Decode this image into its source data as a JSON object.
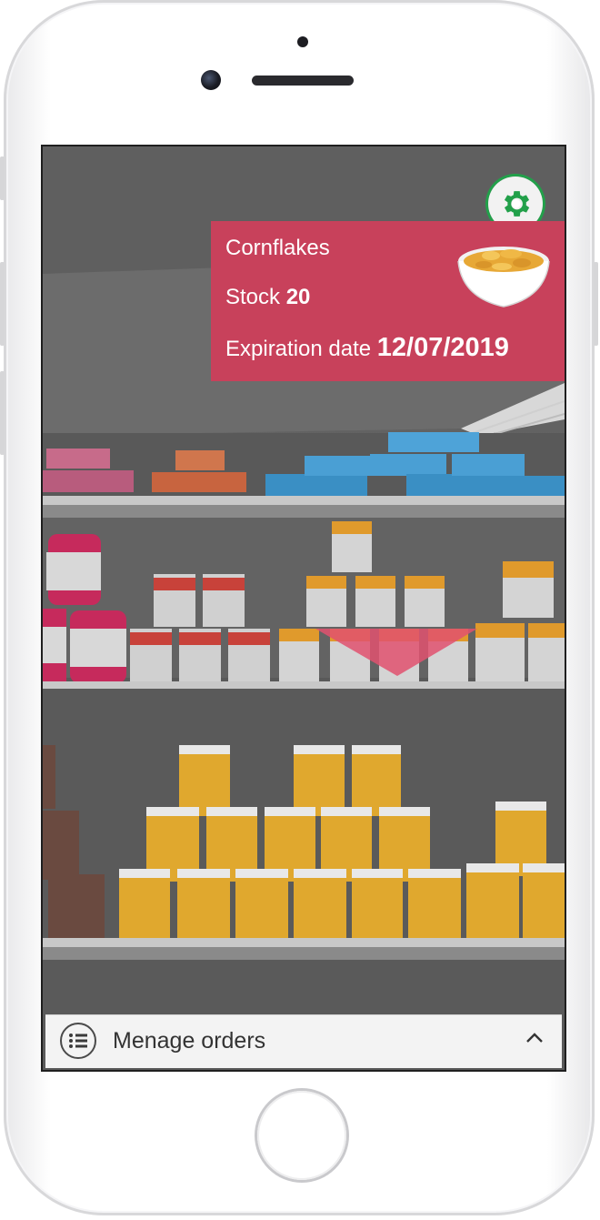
{
  "app": {
    "background_color": "#ffffff",
    "accent_color": "#c8415b",
    "settings_ring_color": "#22a04a"
  },
  "product_card": {
    "name": "Cornflakes",
    "stock_label": "Stock",
    "stock_value": "20",
    "expiration_label": "Expiration date",
    "expiration_value": "12/07/2019",
    "image_icon": "cereal-bowl-icon"
  },
  "settings": {
    "icon": "gear-icon"
  },
  "bottom_bar": {
    "icon": "list-icon",
    "label": "Menage orders",
    "chevron_icon": "chevron-up-icon"
  }
}
